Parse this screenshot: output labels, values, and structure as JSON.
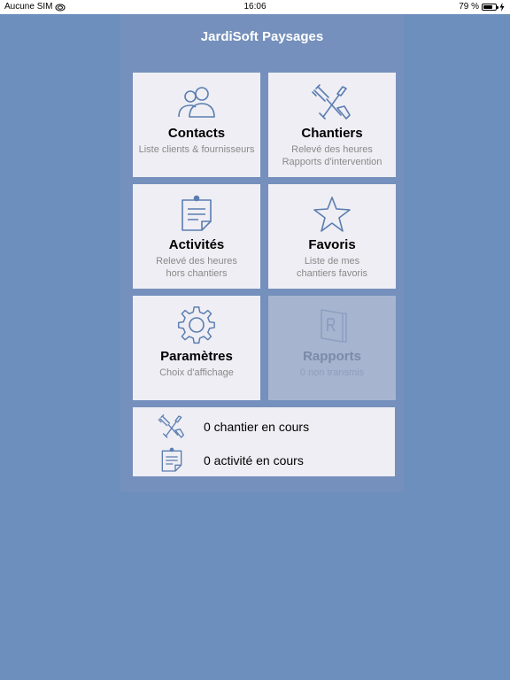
{
  "status_bar": {
    "carrier": "Aucune SIM",
    "time": "16:06",
    "battery": "79 %",
    "battery_level": 0.79
  },
  "app": {
    "title": "JardiSoft Paysages"
  },
  "tiles": [
    {
      "title": "Contacts",
      "subtitle_1": "Liste clients & fournisseurs",
      "subtitle_2": "",
      "icon": "contacts-icon"
    },
    {
      "title": "Chantiers",
      "subtitle_1": "Relevé des heures",
      "subtitle_2": "Rapports d'intervention",
      "icon": "tools-icon"
    },
    {
      "title": "Activités",
      "subtitle_1": "Relevé des heures",
      "subtitle_2": "hors chantiers",
      "icon": "clipboard-icon"
    },
    {
      "title": "Favoris",
      "subtitle_1": "Liste de mes",
      "subtitle_2": "chantiers favoris",
      "icon": "star-icon"
    },
    {
      "title": "Paramètres",
      "subtitle_1": "Choix d'affichage",
      "subtitle_2": "",
      "icon": "gear-icon"
    },
    {
      "title": "Rapports",
      "subtitle_1": "0 non transmis",
      "subtitle_2": "",
      "icon": "report-icon"
    }
  ],
  "summary": {
    "chantiers": "0 chantier en cours",
    "activites": "0 activité en cours"
  },
  "colors": {
    "background": "#6d8fbd",
    "tile": "#eeeef4",
    "icon": "#5b7db0"
  }
}
